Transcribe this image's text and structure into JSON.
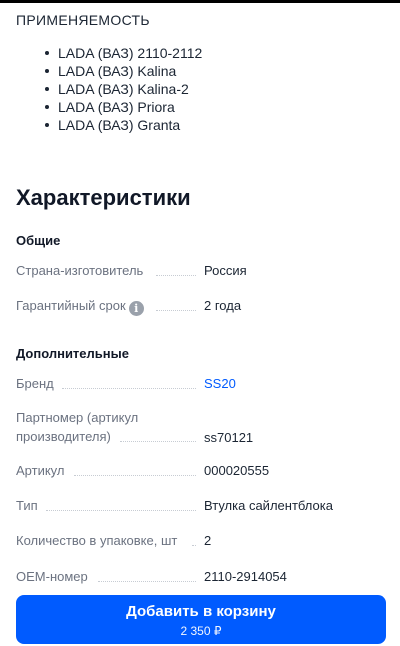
{
  "compatibility": {
    "heading": "ПРИМЕНЯЕМОСТЬ",
    "models": [
      "LADA (ВАЗ) 2110-2112",
      "LADA (ВАЗ) Kalina",
      "LADA (ВАЗ) Kalina-2",
      "LADA (ВАЗ) Priora",
      "LADA (ВАЗ) Granta"
    ]
  },
  "specs": {
    "title": "Характеристики",
    "general": {
      "title": "Общие",
      "rows": [
        {
          "label": "Страна-изготовитель",
          "value": "Россия"
        },
        {
          "label": "Гарантийный срок",
          "value": "2 года",
          "info_icon": "info-icon"
        }
      ]
    },
    "additional": {
      "title": "Дополнительные",
      "rows": [
        {
          "label": "Бренд",
          "value": "SS20",
          "link": true
        },
        {
          "label": "Партномер (артикул производителя)",
          "value": "ss70121"
        },
        {
          "label": "Артикул",
          "value": "000020555"
        },
        {
          "label": "Тип",
          "value": "Втулка сайлентблока"
        },
        {
          "label": "Количество в упаковке, шт",
          "value": "2"
        },
        {
          "label": "OEM-номер",
          "value": "2110-2914054"
        }
      ]
    }
  },
  "cart_button": {
    "label": "Добавить в корзину",
    "price": "2 350 ₽"
  },
  "colors": {
    "accent": "#005bff",
    "text": "#1b2533",
    "muted": "#6b7280"
  }
}
